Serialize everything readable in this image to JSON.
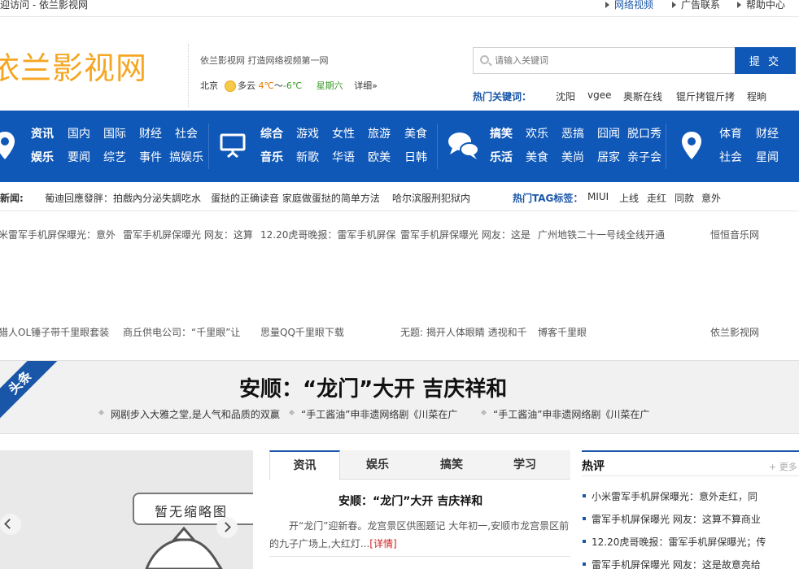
{
  "topbar": {
    "welcome": "欢迎访问 - 依兰影视网",
    "links": [
      "网络视频",
      "广告联系",
      "帮助中心"
    ]
  },
  "header": {
    "logo": "依兰影视网",
    "slogan": "依兰影视网 打造网络视频第一网",
    "weather": {
      "city": "北京",
      "condition": "多云",
      "temp_high": "4℃",
      "sep": "～",
      "temp_low": "-6℃",
      "weekday": "星期六",
      "detail": "详细»"
    },
    "search": {
      "placeholder": "请输入关键词",
      "button": "提 交"
    },
    "hot_keywords_label": "热门关键词：",
    "hot_keywords": [
      "沈阳",
      "vgee",
      "奥斯在线",
      "锟斤拷锟斤拷",
      "程晌"
    ]
  },
  "nav": {
    "group1": {
      "row1": [
        "资讯",
        "国内",
        "国际",
        "财经",
        "社会"
      ],
      "row2": [
        "娱乐",
        "要闻",
        "综艺",
        "事件",
        "搞娱乐"
      ]
    },
    "group2": {
      "row1": [
        "综合",
        "游戏",
        "女性",
        "旅游",
        "美食"
      ],
      "row2": [
        "音乐",
        "新歌",
        "华语",
        "欧美",
        "日韩"
      ]
    },
    "group3": {
      "row1": [
        "搞笑",
        "欢乐",
        "恶搞",
        "囧闻",
        "脱口秀"
      ],
      "row2": [
        "乐活",
        "美食",
        "美尚",
        "居家",
        "亲子会"
      ]
    },
    "group4": {
      "row1": [
        "体育",
        "财经"
      ],
      "row2": [
        "社会",
        "星闻"
      ]
    },
    "icons": [
      "location-icon",
      "screen-icon",
      "chat-icon",
      "location-icon"
    ]
  },
  "newsline": {
    "label": "最新新闻:",
    "items": [
      "葡迪回應發胖：拍戲內分泌失調吃水",
      "蛋挞的正确读音 家庭做蛋挞的简单方法",
      "哈尔滨服刑犯狱内"
    ],
    "tag_label": "热门TAG标签：",
    "tags": [
      "MIUI",
      "上线",
      "走红",
      "同款",
      "意外"
    ]
  },
  "link_row1": {
    "items": [
      "小米雷军手机屏保曝光：意外",
      "雷军手机屏保曝光 网友：这算",
      "12.20虎哥晚报：雷军手机屏保",
      "雷军手机屏保曝光 网友：这是",
      "广州地铁二十一号线全线开通"
    ],
    "source": "恒恒音乐网"
  },
  "link_row2": {
    "items": [
      "劲猎人OL锤子带千里眼套装",
      "商丘供电公司：“千里眼”让",
      "思量QQ千里眼下载",
      "无题: 揭开人体眼睛 透视和千",
      "博客千里眼"
    ],
    "source": "依兰影视网"
  },
  "headline": {
    "ribbon": "头条",
    "title": "安顺：“龙门”大开 吉庆祥和",
    "subs": [
      "网剧步入大雅之堂,是人气和品质的双赢",
      "“手工酱油”申非遗网络剧《川菜在广",
      "“手工酱油”申非遗网络剧《川菜在广"
    ]
  },
  "slider": {
    "placeholder": "暂无缩略图"
  },
  "tabs": [
    "资讯",
    "娱乐",
    "搞笑",
    "学习"
  ],
  "article": {
    "title": "安顺：“龙门”大开 吉庆祥和",
    "body": "开“龙门”迎新春。龙宫景区供图题记 大年初一,安顺市龙宫景区前的九子广场上,大红灯...",
    "more": "[详情]"
  },
  "hot_comments": {
    "title": "热评",
    "more": "+ 更多",
    "items": [
      "小米雷军手机屏保曝光：意外走红，同",
      "雷军手机屏保曝光 网友：这算不算商业",
      "12.20虎哥晚报：雷军手机屏保曝光；传",
      "雷军手机屏保曝光 网友：这是故意亮给"
    ]
  },
  "colors": {
    "brand_blue": "#1058b8",
    "logo_orange": "#f5a623"
  }
}
